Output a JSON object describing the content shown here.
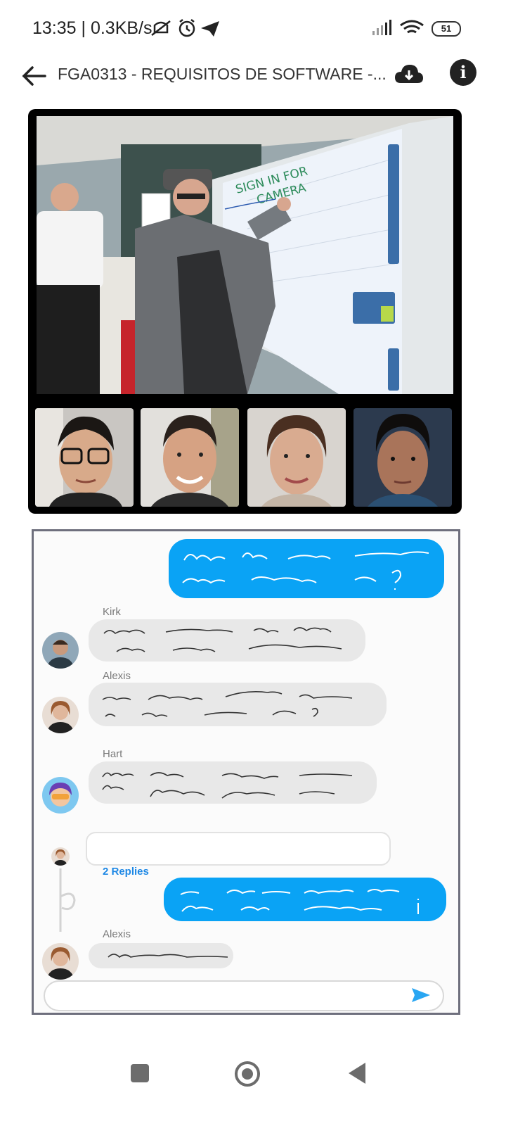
{
  "status_bar": {
    "time_speed": "13:35 | 0.3KB/s",
    "battery": "51",
    "icons": [
      "mute-icon",
      "alarm-icon",
      "telegram-icon",
      "signal-icon",
      "wifi-icon",
      "battery-icon"
    ]
  },
  "header": {
    "title": "FGA0313 - REQUISITOS DE SOFTWARE -...",
    "back_icon": "arrow-left-icon",
    "download_icon": "cloud-download-icon",
    "info_label": "i"
  },
  "video": {
    "main_whiteboard_text": [
      "SIGN IN FOR",
      "CAMERA"
    ],
    "participants": [
      "participant-1",
      "participant-2",
      "participant-3",
      "participant-4"
    ]
  },
  "chat": {
    "messages": [
      {
        "sender": "Kirk"
      },
      {
        "sender": "Alexis"
      },
      {
        "sender": "Hart"
      }
    ],
    "thread_replies_label": "2 Replies",
    "last_sender": "Alexis",
    "send_icon": "send-icon"
  },
  "colors": {
    "accent_blue": "#0aa3f5",
    "panel_border": "#6e6f7d",
    "bubble_gray": "#e8e8e8"
  }
}
